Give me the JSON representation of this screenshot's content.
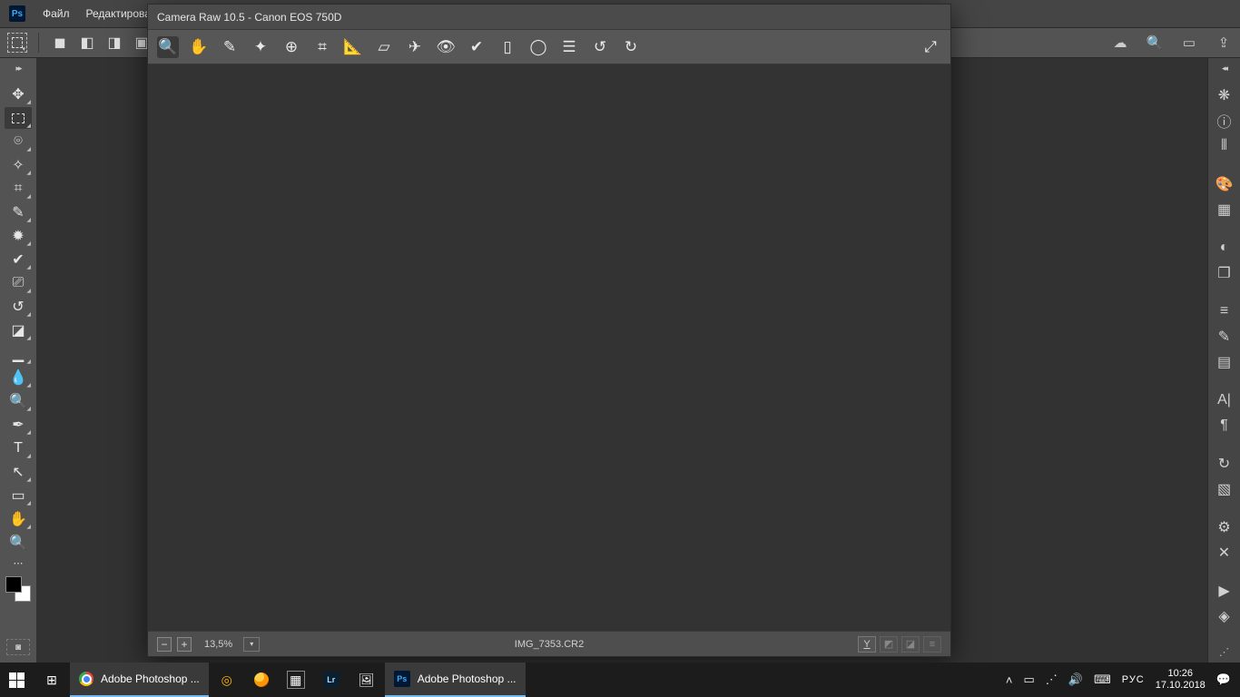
{
  "ps": {
    "logo": "Ps",
    "menu": {
      "file": "Файл",
      "edit": "Редактирован"
    }
  },
  "options": {
    "marquee_corner": "▾"
  },
  "tb_right_search": "🔍",
  "cr": {
    "title": "Camera Raw 10.5  -  Canon EOS 750D",
    "zoom": "13,5%",
    "filename": "IMG_7353.CR2",
    "y_label": "Y"
  },
  "taskbar": {
    "items": [
      {
        "label": "Adobe Photoshop ..."
      },
      {
        "label": ""
      },
      {
        "label": ""
      },
      {
        "label": ""
      },
      {
        "label": ""
      },
      {
        "label": ""
      },
      {
        "label": "Adobe Photoshop ..."
      }
    ],
    "lang": "РУС",
    "time": "10:26",
    "date": "17.10.2018"
  }
}
